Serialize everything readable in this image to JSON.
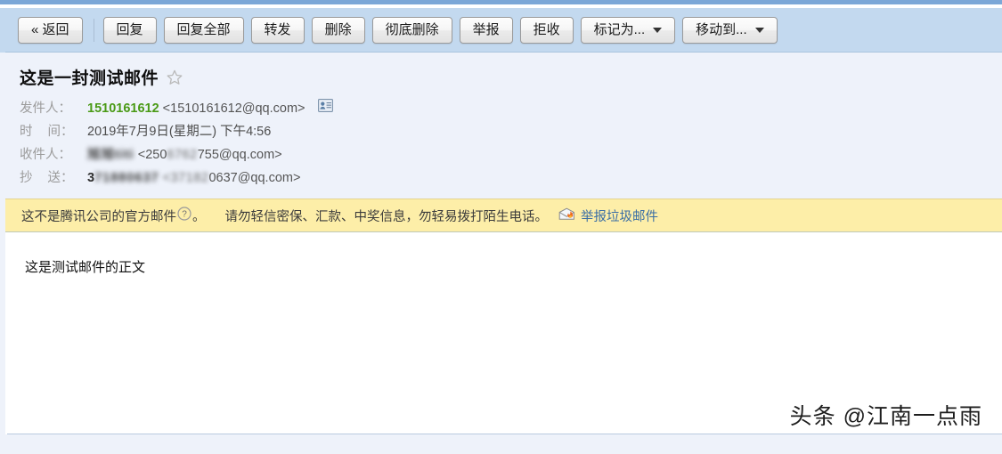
{
  "toolbar": {
    "buttons": [
      {
        "label": "« 返回",
        "name": "back-button",
        "dropdown": false
      },
      {
        "label": "回复",
        "name": "reply-button",
        "dropdown": false
      },
      {
        "label": "回复全部",
        "name": "reply-all-button",
        "dropdown": false
      },
      {
        "label": "转发",
        "name": "forward-button",
        "dropdown": false
      },
      {
        "label": "删除",
        "name": "delete-button",
        "dropdown": false
      },
      {
        "label": "彻底删除",
        "name": "delete-permanently-button",
        "dropdown": false
      },
      {
        "label": "举报",
        "name": "report-button",
        "dropdown": false
      },
      {
        "label": "拒收",
        "name": "reject-button",
        "dropdown": false
      },
      {
        "label": "标记为...",
        "name": "mark-as-dropdown",
        "dropdown": true
      },
      {
        "label": "移动到...",
        "name": "move-to-dropdown",
        "dropdown": true
      }
    ]
  },
  "mail": {
    "subject": "这是一封测试邮件",
    "star_icon": "star-outline-icon",
    "fields": {
      "from_label": "发件人：",
      "from_name": "1510161612",
      "from_address": "<1510161612@qq.com>",
      "contact_card_icon": "contact-card-icon",
      "date_label_a": "时",
      "date_label_b": "间：",
      "date_value": "2019年7月9日(星期二) 下午4:56",
      "to_label": "收件人：",
      "to_name_redacted": "旭旭titi",
      "to_address_prefix": "<250",
      "to_address_redacted": "6762",
      "to_address_suffix": "755@qq.com>",
      "cc_label_a": "抄",
      "cc_label_b": "送：",
      "cc_name_visible": "3",
      "cc_name_redacted": "71880637",
      "cc_address_prefix": "<371",
      "cc_address_redacted": "82",
      "cc_address_suffix": "0637@qq.com>"
    },
    "body_text": "这是测试邮件的正文"
  },
  "warning": {
    "text_before_icon": "这不是腾讯公司的官方邮件",
    "help_icon": "question-mark-circle-icon",
    "text_after_icon": "。",
    "advice": "请勿轻信密保、汇款、中奖信息，勿轻易拨打陌生电话。",
    "report_icon": "spam-report-flame-icon",
    "report_link": "举报垃圾邮件"
  },
  "watermark": {
    "text": "头条 @江南一点雨"
  },
  "colors": {
    "toolbar_bg": "#c3d9ef",
    "header_bg": "#eef2fa",
    "warning_bg": "#fdeea8",
    "sender_green": "#4a9a16",
    "link_blue": "#3a6ea5"
  }
}
